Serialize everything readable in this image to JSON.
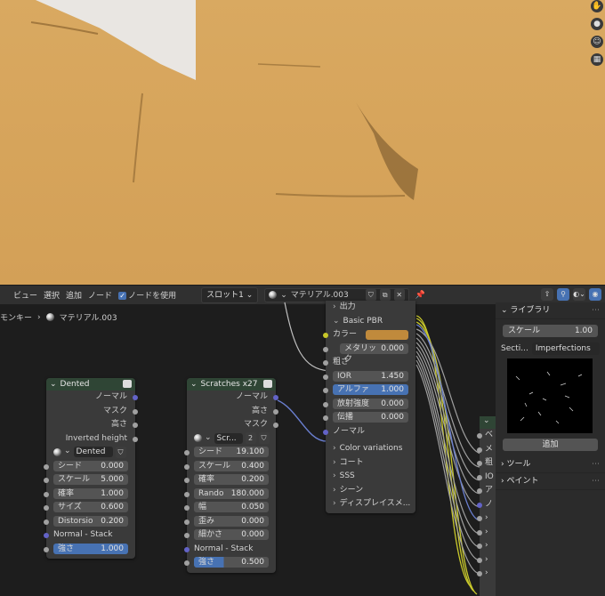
{
  "viewport": {
    "icons": [
      "hand-icon",
      "camera-icon",
      "person-icon",
      "grid-icon"
    ]
  },
  "header": {
    "menus": [
      "ビュー",
      "選択",
      "追加",
      "ノード"
    ],
    "use_nodes_label": "ノードを使用",
    "slot_label": "スロット1",
    "material_name": "マテリアル.003"
  },
  "breadcrumb": {
    "object": "モンキー",
    "material": "マテリアル.003"
  },
  "nodes": {
    "dented": {
      "title": "Dented",
      "outputs": [
        "ノーマル",
        "マスク",
        "高さ",
        "Inverted height"
      ],
      "preset": "Dented",
      "fields": [
        {
          "k": "シード",
          "v": "0.000"
        },
        {
          "k": "スケール",
          "v": "5.000"
        },
        {
          "k": "確率",
          "v": "1.000"
        },
        {
          "k": "サイズ",
          "v": "0.600"
        },
        {
          "k": "Distorsio",
          "v": "0.200"
        }
      ],
      "normal_label": "Normal - Stack",
      "strength": {
        "k": "強さ",
        "v": "1.000"
      }
    },
    "scratches": {
      "title": "Scratches x27",
      "badge": "2",
      "outputs": [
        "ノーマル",
        "高さ",
        "マスク"
      ],
      "preset": "Scr...",
      "preset_count": "2",
      "fields": [
        {
          "k": "シード",
          "v": "19.100"
        },
        {
          "k": "スケール",
          "v": "0.400"
        },
        {
          "k": "確率",
          "v": "0.200"
        },
        {
          "k": "Rando",
          "v": "180.000"
        },
        {
          "k": "幅",
          "v": "0.050"
        },
        {
          "k": "歪み",
          "v": "0.000"
        },
        {
          "k": "細かさ",
          "v": "0.000"
        }
      ],
      "normal_label": "Normal - Stack",
      "strength": {
        "k": "強さ",
        "v": "0.500"
      }
    },
    "material": {
      "output_label": "出力",
      "basic_label": "Basic PBR",
      "color_label": "カラー",
      "color_hex": "#c08a3c",
      "metallic": {
        "k": "メタリック",
        "v": "0.000"
      },
      "roughness_label": "粗さ",
      "ior": {
        "k": "IOR",
        "v": "1.450"
      },
      "alpha": {
        "k": "アルファ",
        "v": "1.000"
      },
      "emission": {
        "k": "放射強度",
        "v": "0.000"
      },
      "transmission": {
        "k": "伝播",
        "v": "0.000"
      },
      "normal_label": "ノーマル",
      "panels": [
        "Color variations",
        "コート",
        "SSS",
        "シーン",
        "ディスプレイスメ..."
      ]
    },
    "partial": {
      "sockets": [
        "ベ",
        "メ",
        "粗",
        "IO",
        "ア",
        "ノ"
      ]
    }
  },
  "npanel": {
    "library_label": "ライブラリ",
    "scale": {
      "k": "スケール",
      "v": "1.00"
    },
    "section_label": "Secti...",
    "section_value": "Imperfections",
    "add_label": "追加",
    "tools_label": "ツール",
    "paint_label": "ペイント"
  }
}
